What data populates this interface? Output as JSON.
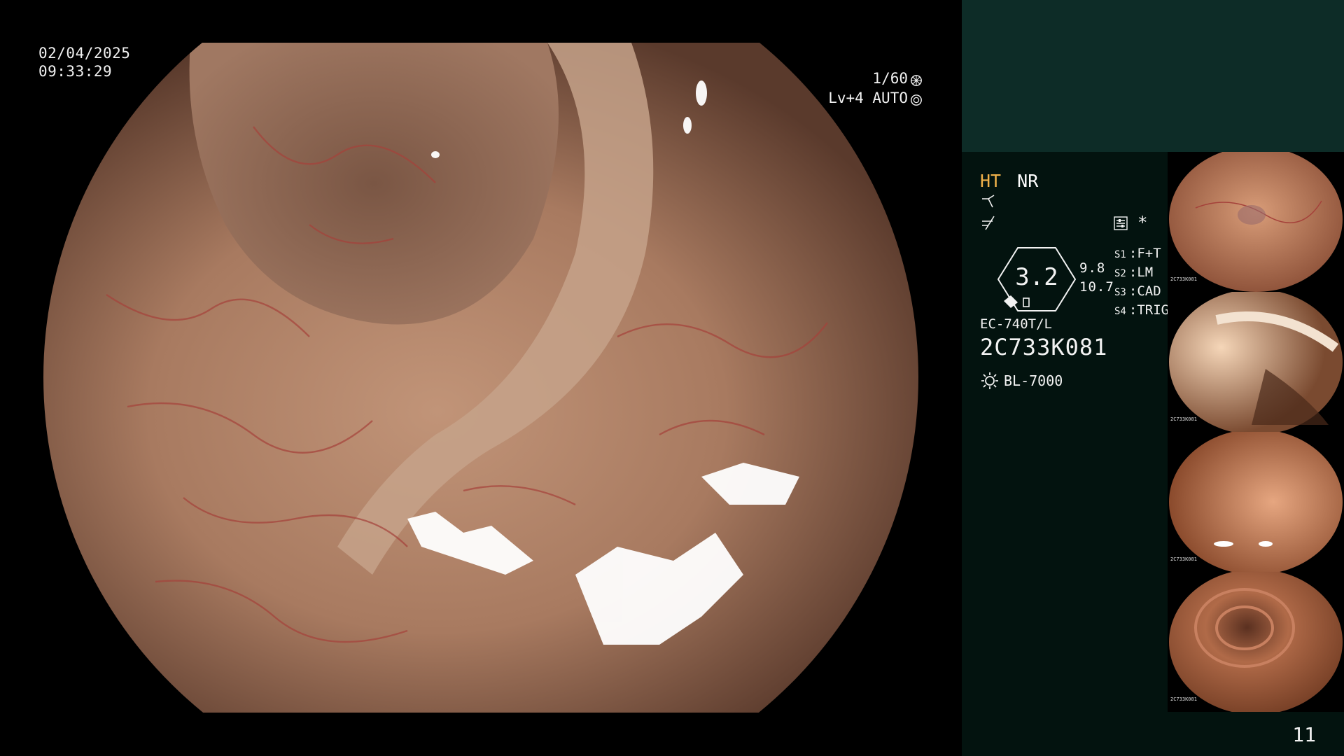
{
  "overlay": {
    "date": "02/04/2025",
    "time": "09:33:29",
    "shutter": "1/60",
    "iris_mode": "Lv+4 AUTO",
    "icons": [
      "shutter-icon",
      "iris-icon"
    ]
  },
  "panel": {
    "mode_ht": "HT",
    "mode_nr": "NR",
    "enhancement_icons": [
      "structure-enhance-icon",
      "contrast-enhance-icon"
    ],
    "settings_icon": "settings-icon",
    "star": "*",
    "scope_shape_value": "3.2",
    "scope_values": [
      "9.8",
      "10.7"
    ],
    "switches": [
      {
        "key": "S1",
        "value": "F+T"
      },
      {
        "key": "S2",
        "value": "LM"
      },
      {
        "key": "S3",
        "value": "CAD"
      },
      {
        "key": "S4",
        "value": "TRIG"
      }
    ],
    "scope_model": "EC-740T/L",
    "serial": "2C733K081",
    "light_source": "BL-7000",
    "colors": {
      "ht": "#f0b14a",
      "top_band": "#0d2c27",
      "panel_bg": "#03130f"
    }
  },
  "thumbnails": [
    {
      "serial": "2C733K081"
    },
    {
      "serial": "2C733K081"
    },
    {
      "serial": "2C733K081"
    },
    {
      "serial": "2C733K081"
    }
  ],
  "page_number": "11"
}
